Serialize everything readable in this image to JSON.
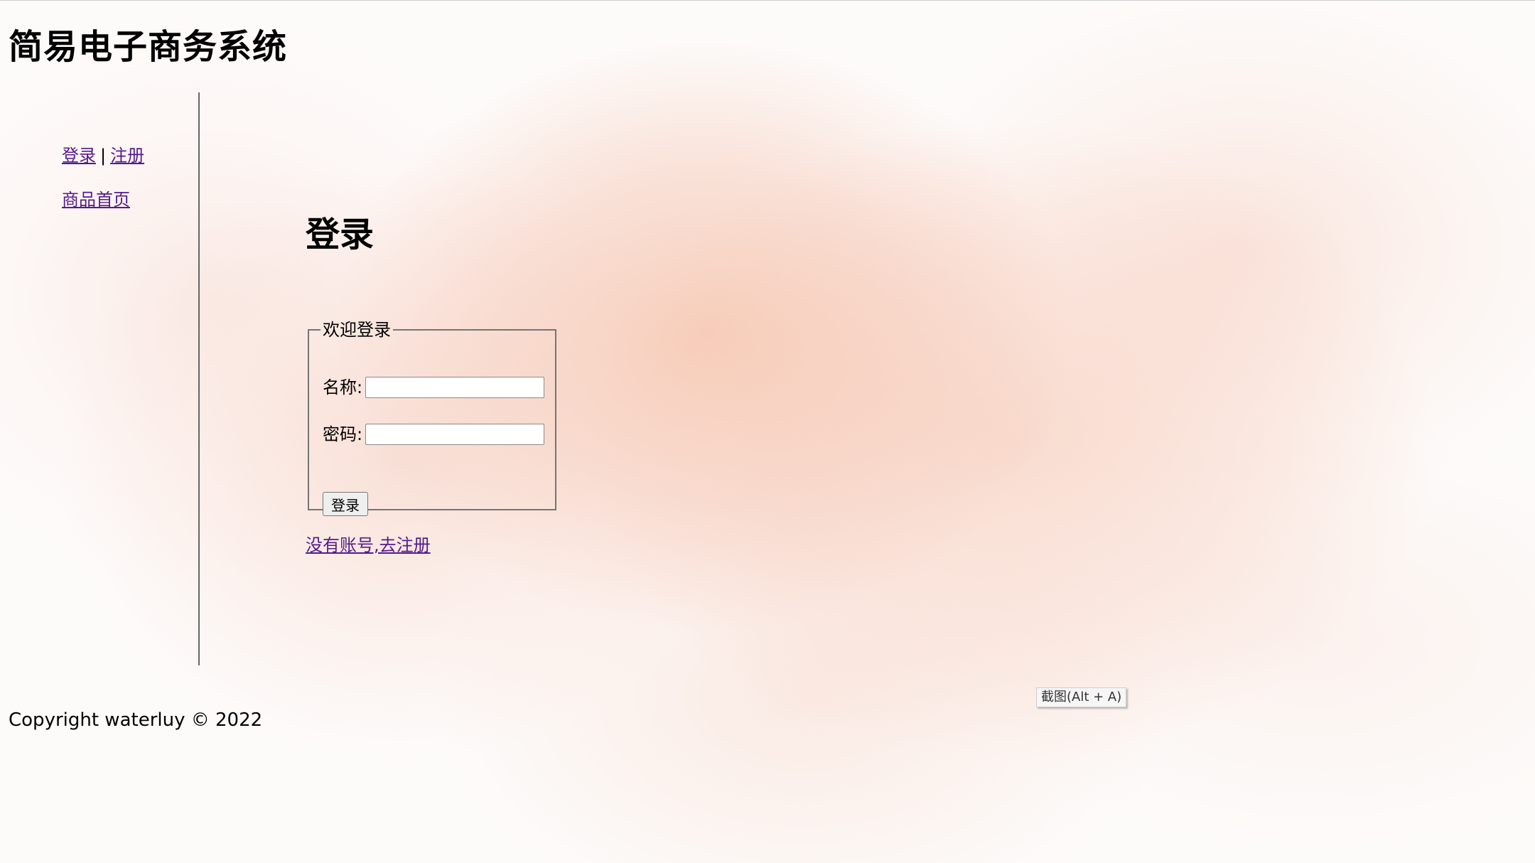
{
  "header": {
    "site_title": "简易电子商务系统"
  },
  "sidebar": {
    "login_link": "登录",
    "separator": "|",
    "register_link": "注册",
    "home_link": "商品首页"
  },
  "main": {
    "heading": "登录",
    "form": {
      "legend": "欢迎登录",
      "name_label": "名称:",
      "name_value": "",
      "password_label": "密码:",
      "password_value": "",
      "submit_label": "登录"
    },
    "register_prompt_link": "没有账号,去注册"
  },
  "footer": {
    "copyright": "Copyright waterluy © 2022"
  },
  "tooltip": {
    "screenshot_hint": "截图(Alt + A)"
  }
}
